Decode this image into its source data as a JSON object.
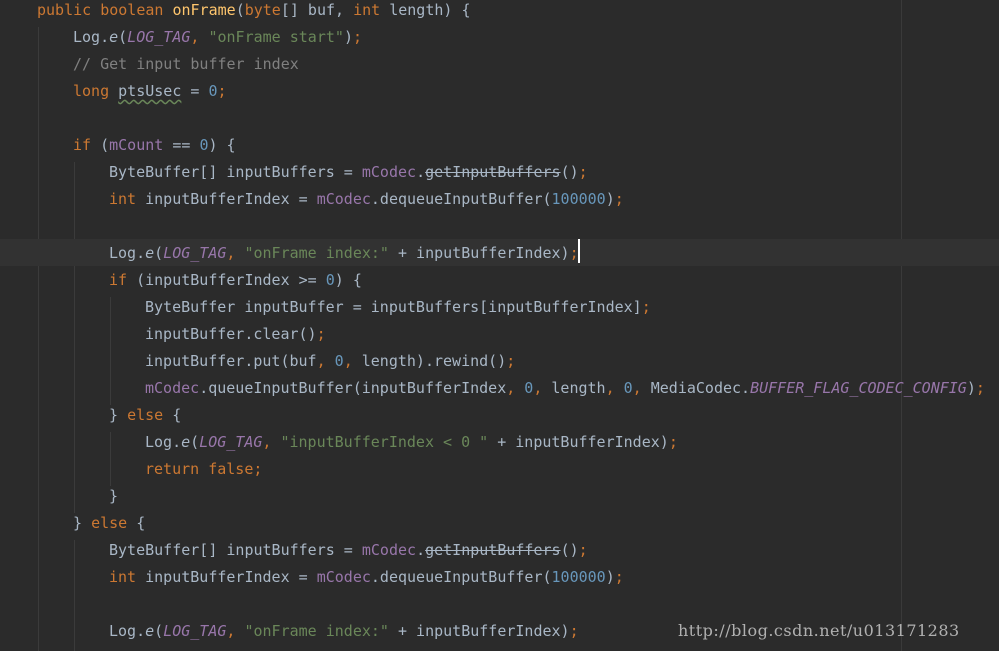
{
  "lines": [
    {
      "t1": "public",
      "t2": " ",
      "t3": "boolean",
      "t4": " ",
      "fn": "onFrame",
      "rest": "(",
      "kw2": "byte",
      "rest2": "[] buf, ",
      "kw3": "int",
      "rest3": " length) {"
    },
    {
      "a": "Log.",
      "b": "e",
      "c": "(",
      "d": "LOG_TAG",
      "e": ", ",
      "f": "\"onFrame start\"",
      "g": ")",
      "h": ";"
    },
    {
      "comment": "// Get input buffer index"
    },
    {
      "kw": "long",
      "a": " ",
      "var": "ptsUsec",
      "b": " = ",
      "num": "0",
      "semi": ";"
    },
    {},
    {
      "kw": "if",
      "a": " (",
      "field": "mCount",
      "b": " == ",
      "num": "0",
      "c": ") {"
    },
    {
      "a": "ByteBuffer[] inputBuffers = ",
      "field": "mCodec",
      "b": ".",
      "dep": "getInputBuffers",
      "c": "()",
      "semi": ";"
    },
    {
      "kw": "int",
      "a": " inputBufferIndex = ",
      "field": "mCodec",
      "b": ".dequeueInputBuffer(",
      "num": "100000",
      "c": ")",
      "semi": ";"
    },
    {},
    {
      "a": "Log.",
      "b": "e",
      "c": "(",
      "d": "LOG_TAG",
      "e": ", ",
      "f": "\"onFrame index:\"",
      "g": " + inputBufferIndex)",
      "h": ";"
    },
    {
      "kw": "if",
      "a": " (inputBufferIndex >= ",
      "num": "0",
      "b": ") {"
    },
    {
      "a": "ByteBuffer inputBuffer = inputBuffers[inputBufferIndex]",
      "semi": ";"
    },
    {
      "a": "inputBuffer.clear()",
      "semi": ";"
    },
    {
      "a": "inputBuffer.put(buf",
      "c1": ", ",
      "num": "0",
      "c2": ", ",
      "b": "length).rewind()",
      "semi": ";"
    },
    {
      "field": "mCodec",
      "a": ".queueInputBuffer(inputBufferIndex",
      "c1": ", ",
      "n1": "0",
      "c2": ", ",
      "b": "length",
      "c3": ", ",
      "n2": "0",
      "c4": ", ",
      "c": "MediaCodec.",
      "static": "BUFFER_FLAG_CODEC_CONFIG",
      "d": ")",
      "semi": ";"
    },
    {
      "a": "} ",
      "kw": "else",
      "b": " {"
    },
    {
      "a": "Log.",
      "b": "e",
      "c": "(",
      "d": "LOG_TAG",
      "e": ", ",
      "f": "\"inputBufferIndex < 0 \"",
      "g": " + inputBufferIndex)",
      "h": ";"
    },
    {
      "kw": "return",
      "a": " ",
      "kw2": "false",
      "semi": ";"
    },
    {
      "a": "}"
    },
    {
      "a": "} ",
      "kw": "else",
      "b": " {"
    },
    {
      "a": "ByteBuffer[] inputBuffers = ",
      "field": "mCodec",
      "b": ".",
      "dep": "getInputBuffers",
      "c": "()",
      "semi": ";"
    },
    {
      "kw": "int",
      "a": " inputBufferIndex = ",
      "field": "mCodec",
      "b": ".dequeueInputBuffer(",
      "num": "100000",
      "c": ")",
      "semi": ";"
    },
    {},
    {
      "a": "Log.",
      "b": "e",
      "c": "(",
      "d": "LOG_TAG",
      "e": ", ",
      "f": "\"onFrame index:\"",
      "g": " + inputBufferIndex)",
      "h": ";"
    }
  ],
  "watermark": "http://blog.csdn.net/u013171283",
  "colors": {
    "background": "#2b2b2b",
    "keyword": "#cc7832",
    "method": "#ffc66d",
    "field": "#9876aa",
    "string": "#6a8759",
    "number": "#6897bb",
    "comment": "#808080",
    "text": "#a9b7c6"
  }
}
